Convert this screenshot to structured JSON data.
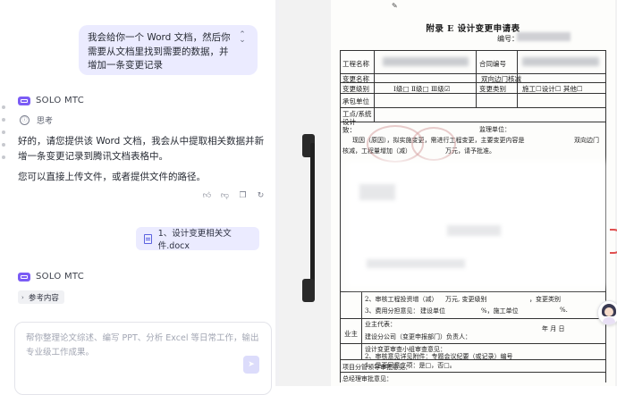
{
  "chat": {
    "user_message": "我会给你一个 Word 文档，然后你需要从文档里找到需要的数据，并增加一条变更记录",
    "assistant_name": "SOLO MTC",
    "thinking_label": "思考",
    "reply_paragraphs": [
      "好的，请您提供该 Word 文档，我会从中提取相关数据并新增一条变更记录到腾讯文档表格中。",
      "您可以直接上传文件，或者提供文件的路径。"
    ],
    "attachment_name": "1、设计变更相关文件.docx",
    "second_assistant_name": "SOLO MTC",
    "reference_label": "参考内容",
    "input_placeholder": "帮你整理论文综述、编写 PPT、分析 Excel 等日常工作，输出专业级工作成果。"
  },
  "document": {
    "title": "附录 E  设计变更申请表",
    "serial_label": "编号：",
    "rows": {
      "project_name": "工程名称",
      "contract_no": "合同编号",
      "change_name": "变更名称",
      "change_name_value": "双向边门核减",
      "change_level": "变更级别",
      "change_level_options": "Ⅰ级□ Ⅱ级□ Ⅲ级☑",
      "change_type": "变更类别",
      "change_type_options": "施工☐设计☐ 其他☐",
      "applicant": "承包单位",
      "section": "工点/系统设计",
      "reason_prefix": "致：",
      "reason_text": "现因（原因），拟实施变更，需进行工程变更，主要变更内容是",
      "reason_suffix": "双向边门",
      "reason_line2": "核减，工程量增加（减）",
      "reason_line2_tail": "万元，请予批准。",
      "supervisor": "监理单位：",
      "owner_agent": "业主代表",
      "opinion_1": "2、审核工程投资增（减）",
      "opinion_1_tail": "万元, 变更级别",
      "opinion_1_type": "，变更类别",
      "opinion_2": "3、费用分担意见：",
      "opinion_2_unit": "建设单位",
      "opinion_2_pct": "%，施工单位",
      "opinion_2_pct2": "%.",
      "owner_side": "业主",
      "owner_rep_line": "业主代表：",
      "date_line": "年   月   日",
      "build_company": "建设分公司（变更申报部门）负责人：",
      "review_group": "设计变更审查小组审查意见：",
      "review_1": "1、是否同意立项：是□，否□。",
      "review_2": "2、审核意见详见附件：专题会议纪要（或记录）编号",
      "leader_review": "项目分管领导审批意见：",
      "manager_review": "总经理审批意见："
    }
  },
  "icons": {
    "collapse": "collapse-icon",
    "bot_logo": "bot-logo-icon",
    "thinking": "thinking-icon",
    "like": "thumbs-up-icon",
    "dislike": "thumbs-down-icon",
    "copy": "copy-icon",
    "retry": "refresh-icon",
    "file": "file-icon",
    "send": "send-icon"
  },
  "colors": {
    "bubble_bg": "#ebebff",
    "brand": "#7b5cf5",
    "viewer_bg": "#f2f2f2"
  }
}
